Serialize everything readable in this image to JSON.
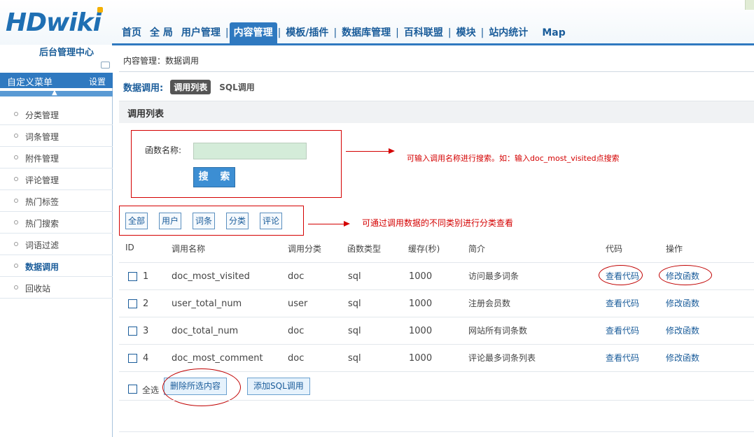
{
  "brand": {
    "logo_text": "HDwik",
    "logo_text_end": "i",
    "subtitle": "后台管理中心"
  },
  "nav": {
    "items": [
      {
        "label": "首页"
      },
      {
        "label": "全 局"
      },
      {
        "label": "用户管理"
      },
      {
        "label": "内容管理",
        "active": true
      },
      {
        "label": "模板/插件"
      },
      {
        "label": "数据库管理"
      },
      {
        "label": "百科联盟"
      },
      {
        "label": "模块"
      },
      {
        "label": "站内统计"
      },
      {
        "label": "Map"
      }
    ]
  },
  "sidebar": {
    "header_label": "自定义菜单",
    "settings_label": "设置",
    "collapse_icon": "chevron-up-icon",
    "items": [
      {
        "label": "分类管理"
      },
      {
        "label": "词条管理"
      },
      {
        "label": "附件管理"
      },
      {
        "label": "评论管理"
      },
      {
        "label": "热门标签"
      },
      {
        "label": "热门搜索"
      },
      {
        "label": "词语过滤"
      },
      {
        "label": "数据调用",
        "active": true
      },
      {
        "label": "回收站"
      }
    ]
  },
  "breadcrumb": "内容管理：数据调用",
  "data_call": {
    "label": "数据调用:",
    "tabs": [
      {
        "label": "调用列表",
        "active": true
      },
      {
        "label": "SQL调用"
      }
    ]
  },
  "list_title": "调用列表",
  "search": {
    "label": "函数名称:",
    "value": "",
    "placeholder": "",
    "button_label": "搜 索",
    "note": "可输入调用名称进行搜索。如：输入doc_most_visited点搜索"
  },
  "filters": {
    "buttons": [
      "全部",
      "用户",
      "词条",
      "分类",
      "评论"
    ],
    "note": "可通过调用数据的不同类别进行分类查看"
  },
  "table": {
    "headers": [
      "ID",
      "调用名称",
      "调用分类",
      "函数类型",
      "缓存(秒)",
      "简介",
      "代码",
      "操作"
    ],
    "rows": [
      {
        "id": "1",
        "name": "doc_most_visited",
        "category": "doc",
        "type": "sql",
        "cache": "1000",
        "desc": "访问最多词条",
        "code": "查看代码",
        "op": "修改函数"
      },
      {
        "id": "2",
        "name": "user_total_num",
        "category": "user",
        "type": "sql",
        "cache": "1000",
        "desc": "注册会员数",
        "code": "查看代码",
        "op": "修改函数"
      },
      {
        "id": "3",
        "name": "doc_total_num",
        "category": "doc",
        "type": "sql",
        "cache": "1000",
        "desc": "网站所有词条数",
        "code": "查看代码",
        "op": "修改函数"
      },
      {
        "id": "4",
        "name": "doc_most_comment",
        "category": "doc",
        "type": "sql",
        "cache": "1000",
        "desc": "评论最多词条列表",
        "code": "查看代码",
        "op": "修改函数"
      }
    ]
  },
  "footer_actions": {
    "select_all_label": "全选",
    "delete_button": "删除所选内容",
    "add_button": "添加SQL调用"
  },
  "colors": {
    "accent": "#2f79c0",
    "annotation": "#d40000",
    "input_bg": "#d4ecd9"
  }
}
